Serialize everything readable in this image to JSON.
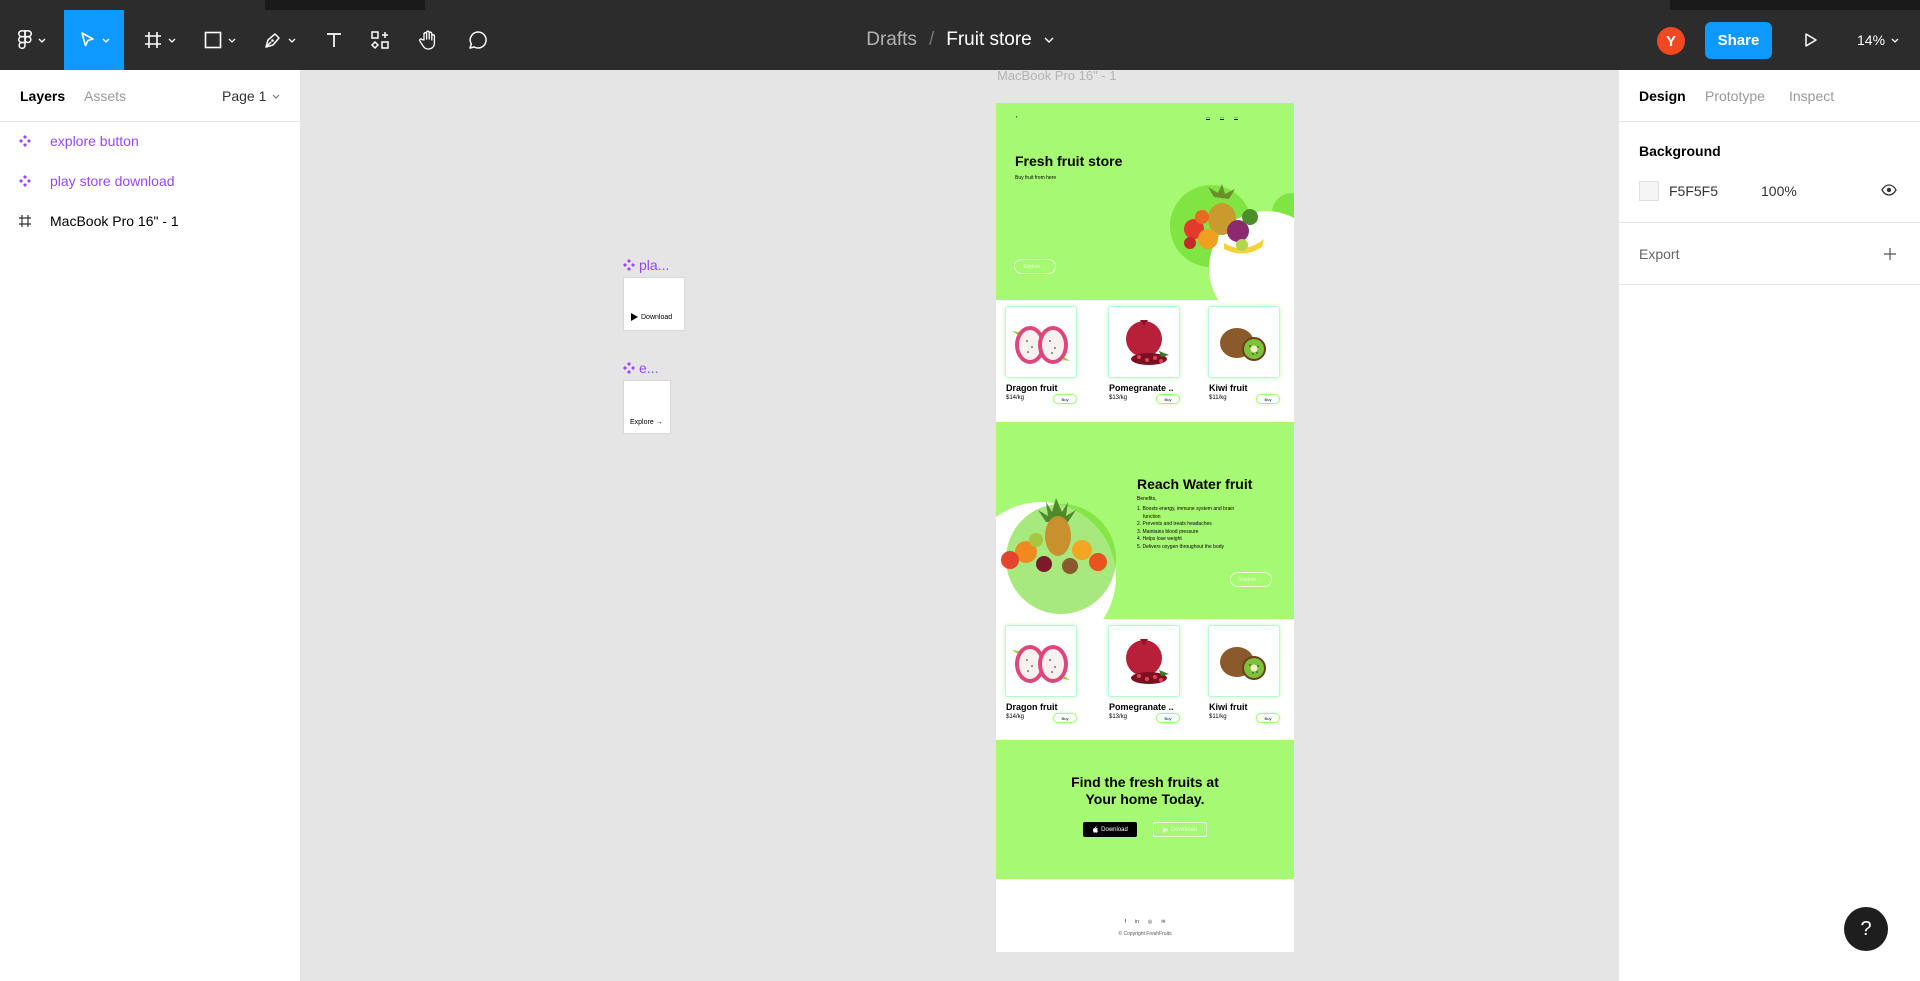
{
  "toolbar": {
    "doc_breadcrumb": "Drafts",
    "doc_separator": "/",
    "file_name": "Fruit store",
    "avatar_initial": "Y",
    "share_label": "Share",
    "zoom_level": "14%"
  },
  "left_panel": {
    "tabs": [
      "Layers",
      "Assets"
    ],
    "page_selector": "Page 1",
    "layers": [
      {
        "name": "explore button",
        "type": "component"
      },
      {
        "name": "play store download",
        "type": "component"
      },
      {
        "name": "MacBook Pro 16\" - 1",
        "type": "frame"
      }
    ]
  },
  "right_panel": {
    "tabs": [
      "Design",
      "Prototype",
      "Inspect"
    ],
    "background_heading": "Background",
    "background_hex": "F5F5F5",
    "background_opacity": "100%",
    "export_heading": "Export"
  },
  "canvas": {
    "frame_label": "MacBook Pro 16\" - 1",
    "components": [
      {
        "label": "pla...",
        "button_text": "Download"
      },
      {
        "label": "e...",
        "button_text": "Explore →"
      }
    ],
    "site": {
      "hero_title": "Fresh fruit store",
      "hero_subtitle": "Buy fruit from here",
      "hero_explore": "Explore →",
      "products": [
        {
          "name": "Dragon fruit",
          "price": "$14/kg",
          "buy": "Buy"
        },
        {
          "name": "Pomegranate ..",
          "price": "$13/kg",
          "buy": "Buy"
        },
        {
          "name": "Kiwi fruit",
          "price": "$11/kg",
          "buy": "Buy"
        }
      ],
      "water_title": "Reach Water fruit",
      "water_subtitle": "Benefits,",
      "water_benefits": [
        "1. Boosts energy, immune system and brain",
        "    function",
        "2. Prevents and treats headaches",
        "3. Maintains blood pressure",
        "4. Helps lose weight",
        "5. Delivers oxygen throughout the body"
      ],
      "water_explore": "Explore →",
      "cta_line1": "Find the fresh fruits at",
      "cta_line2": "Your home Today.",
      "cta_download_apple": "Download",
      "cta_download_play": "Download",
      "footer_copyright": "© Copyright FreshFruits"
    }
  },
  "colors": {
    "accent": "#0d99ff",
    "component_purple": "#9747ff",
    "site_green": "#a6f972",
    "toolbar_bg": "#2c2c2c"
  }
}
